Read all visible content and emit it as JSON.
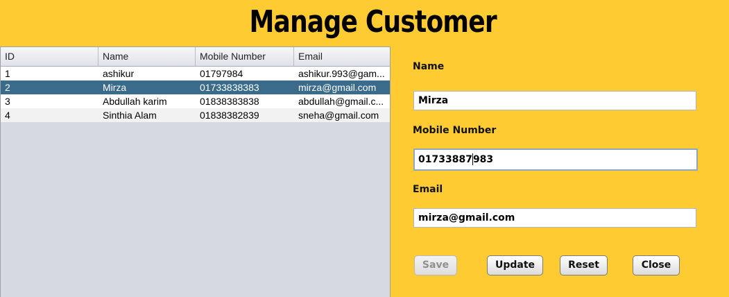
{
  "header": {
    "title": "Manage Customer"
  },
  "table": {
    "columns": [
      "ID",
      "Name",
      "Mobile Number",
      "Email"
    ],
    "rows": [
      [
        "1",
        "ashikur",
        "01797984",
        "ashikur.993@gam..."
      ],
      [
        "2",
        "Mirza",
        "01733838383",
        "mirza@gmail.com"
      ],
      [
        "3",
        "Abdullah karim",
        "01838383838",
        "abdullah@gmail.c..."
      ],
      [
        "4",
        "Sinthia Alam",
        "01838382839",
        "sneha@gmail.com"
      ]
    ],
    "selected_row": 2
  },
  "form": {
    "name_label": "Name",
    "name_value": "Mirza",
    "mobile_label": "Mobile Number",
    "mobile_value_before_caret": "01733887",
    "mobile_value_after_caret": "983",
    "email_label": "Email",
    "email_value": "mirza@gmail.com"
  },
  "buttons": {
    "save": "Save",
    "update": "Update",
    "reset": "Reset",
    "close": "Close"
  },
  "colors": {
    "background": "#ffcb33",
    "selected_row": "#3a6b8a"
  }
}
